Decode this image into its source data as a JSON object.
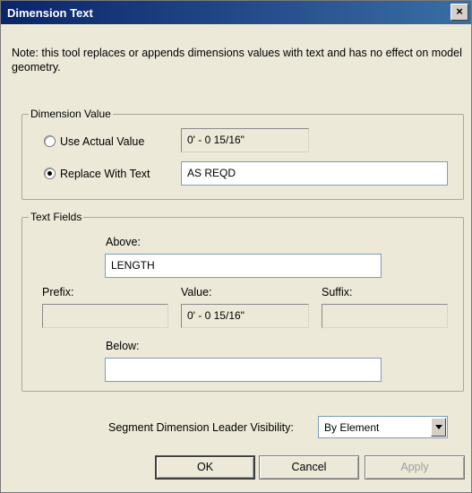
{
  "window": {
    "title": "Dimension Text",
    "close_glyph": "×"
  },
  "note": "Note: this tool replaces or appends dimensions values with text and has no effect on model geometry.",
  "dimension_value": {
    "group_label": "Dimension Value",
    "use_actual_label": "Use Actual Value",
    "use_actual_value": "0' - 0 15/16\"",
    "replace_label": "Replace With Text",
    "replace_value": "AS REQD",
    "selected": "replace"
  },
  "text_fields": {
    "group_label": "Text Fields",
    "above_label": "Above:",
    "above_value": "LENGTH",
    "prefix_label": "Prefix:",
    "prefix_value": "",
    "value_label": "Value:",
    "value_value": "0' - 0 15/16\"",
    "suffix_label": "Suffix:",
    "suffix_value": "",
    "below_label": "Below:",
    "below_value": ""
  },
  "leader": {
    "label": "Segment Dimension Leader Visibility:",
    "selected": "By Element"
  },
  "buttons": {
    "ok": "OK",
    "cancel": "Cancel",
    "apply": "Apply"
  }
}
